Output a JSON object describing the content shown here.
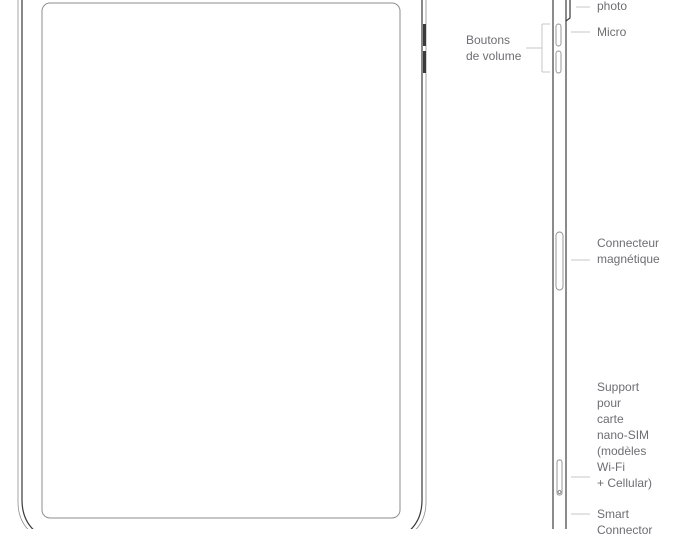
{
  "diagram": {
    "title": "iPad front and side view with component callouts",
    "colors": {
      "outline": "#3a3a3a",
      "screen_outline": "#8e8e8e",
      "leader_line": "#c7c7cc",
      "label_text": "#6e6e73",
      "button_fill": "#3a3a3a"
    },
    "labels": {
      "camera": "photo",
      "micro": "Micro",
      "volume": "Boutons\nde volume",
      "magnetic": "Connecteur\nmagnétique",
      "sim": "Support\npour\ncarte\nnano-SIM\n(modèles\nWi-Fi\n+ Cellular)",
      "smart": "Smart\nConnector"
    }
  }
}
